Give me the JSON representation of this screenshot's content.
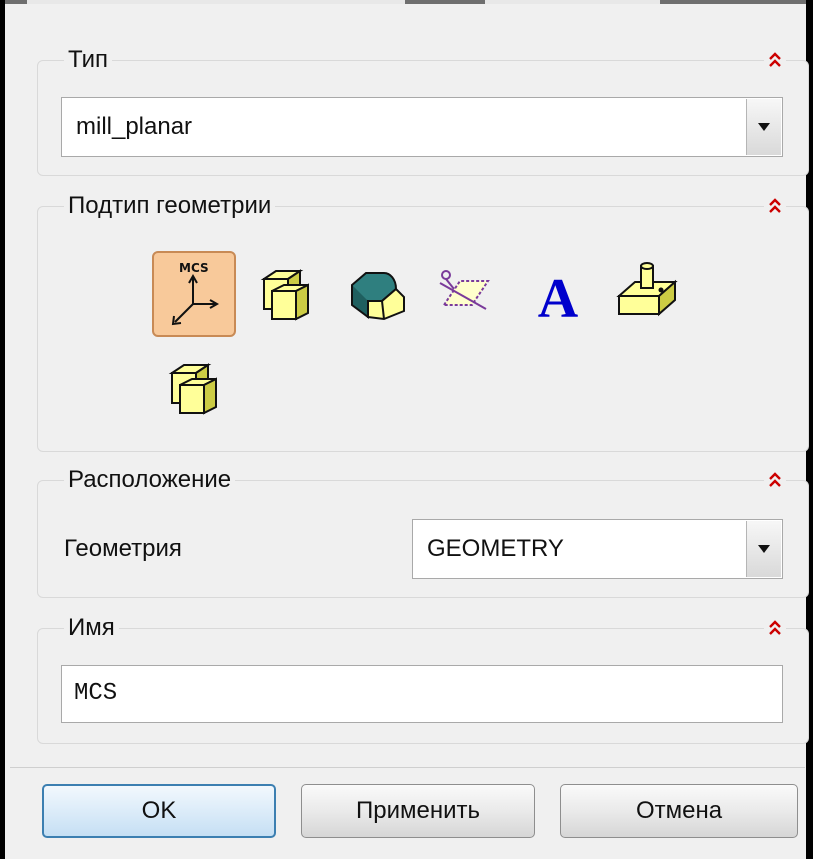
{
  "type_group": {
    "title": "Тип",
    "value": "mill_planar"
  },
  "subtype_group": {
    "title": "Подтип геометрии",
    "icons": [
      {
        "name": "mcs-icon",
        "label": "MCS",
        "selected": true
      },
      {
        "name": "workpiece-icon",
        "selected": false
      },
      {
        "name": "mill-area-icon",
        "selected": false
      },
      {
        "name": "boundary-icon",
        "selected": false
      },
      {
        "name": "text-icon",
        "label": "A",
        "selected": false
      },
      {
        "name": "mill-bnd-icon",
        "selected": false
      },
      {
        "name": "mill-geom-icon",
        "selected": false
      }
    ]
  },
  "location_group": {
    "title": "Расположение",
    "geometry_label": "Геометрия",
    "geometry_value": "GEOMETRY"
  },
  "name_group": {
    "title": "Имя",
    "value": "MCS"
  },
  "buttons": {
    "ok": "OK",
    "apply": "Применить",
    "cancel": "Отмена"
  },
  "colors": {
    "accent_red": "#cc0000",
    "selection_fill": "#f8c99a",
    "icon_yellow": "#ffff99",
    "icon_teal": "#2f7f7f",
    "text_icon_blue": "#0000cc"
  }
}
